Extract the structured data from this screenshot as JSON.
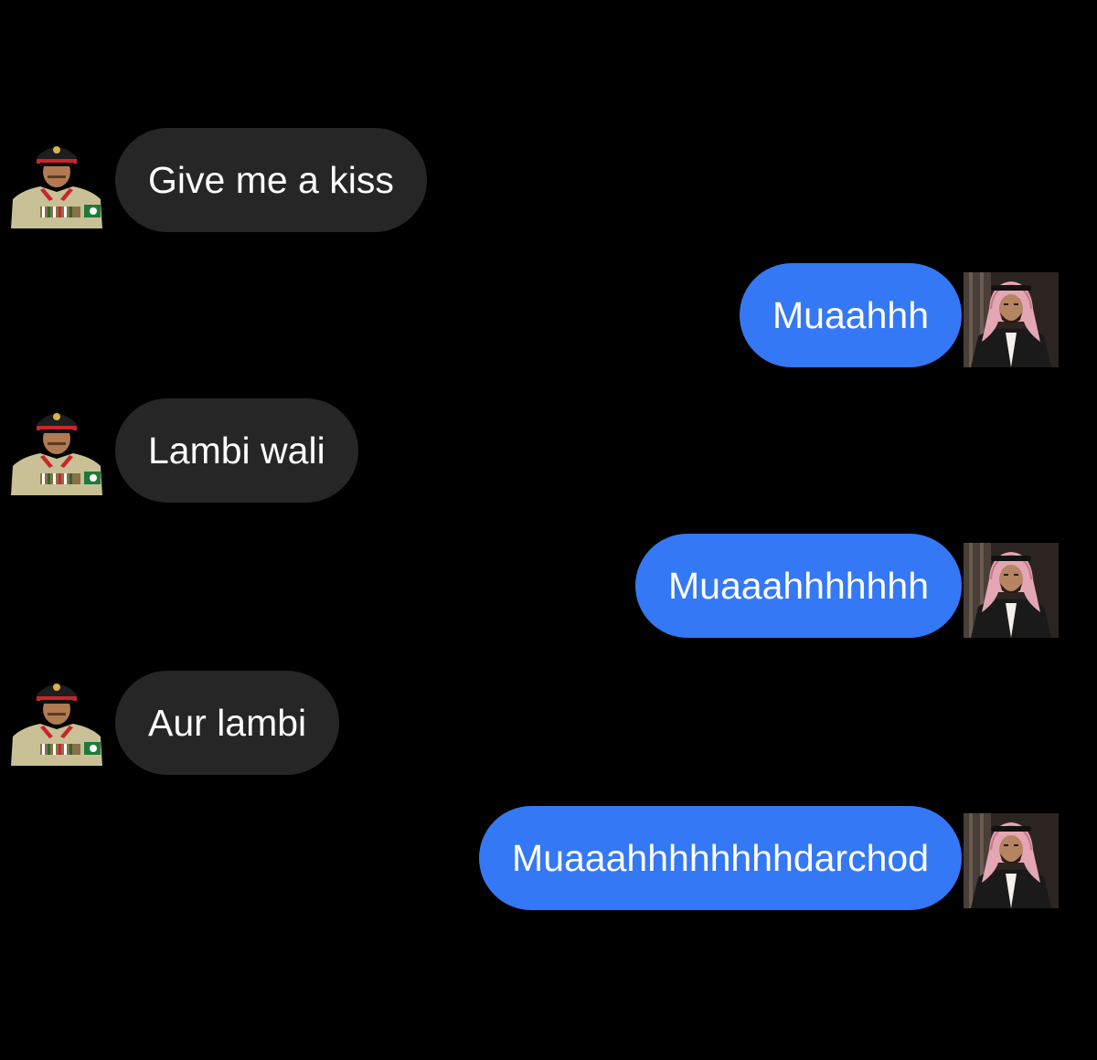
{
  "conversation": {
    "messages": [
      {
        "direction": "incoming",
        "sender_avatar": "military-officer-avatar",
        "text": "Give me a kiss"
      },
      {
        "direction": "outgoing",
        "sender_avatar": "keffiyeh-man-avatar",
        "text": "Muaahhh"
      },
      {
        "direction": "incoming",
        "sender_avatar": "military-officer-avatar",
        "text": "Lambi wali"
      },
      {
        "direction": "outgoing",
        "sender_avatar": "keffiyeh-man-avatar",
        "text": "Muaaahhhhhhh"
      },
      {
        "direction": "incoming",
        "sender_avatar": "military-officer-avatar",
        "text": "Aur lambi"
      },
      {
        "direction": "outgoing",
        "sender_avatar": "keffiyeh-man-avatar",
        "text": "Muaaahhhhhhhhdarchod"
      }
    ]
  },
  "colors": {
    "background": "#000000",
    "incoming_bubble": "#262626",
    "outgoing_bubble": "#3478f6",
    "text": "#ffffff"
  }
}
